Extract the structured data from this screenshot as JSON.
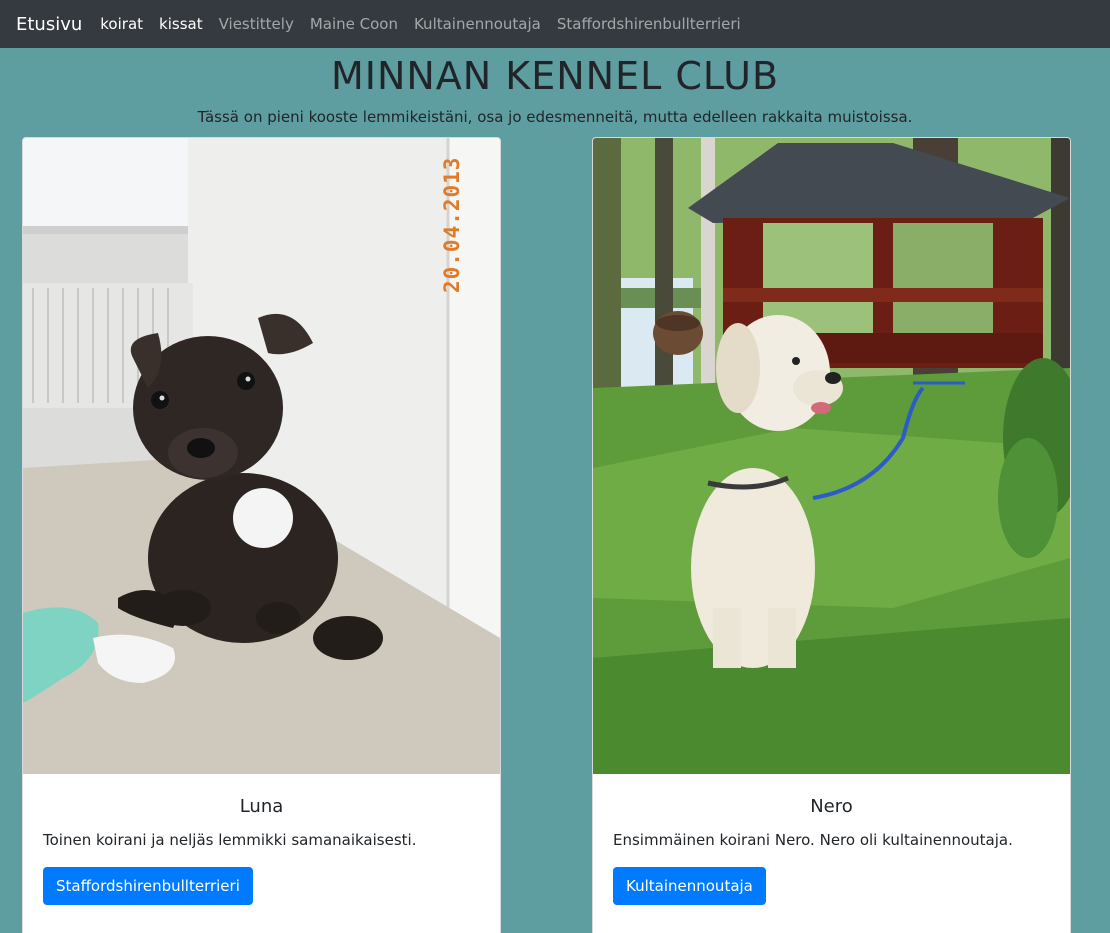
{
  "nav": {
    "brand": "Etusivu",
    "links": [
      {
        "label": "koirat",
        "active": true
      },
      {
        "label": "kissat",
        "active": true
      },
      {
        "label": "Viestittely",
        "active": false
      },
      {
        "label": "Maine Coon",
        "active": false
      },
      {
        "label": "Kultainennoutaja",
        "active": false
      },
      {
        "label": "Staffordshirenbullterrieri",
        "active": false
      }
    ]
  },
  "hero": {
    "title": "MINNAN KENNEL CLUB",
    "subtitle": "Tässä on pieni kooste lemmikeistäni, osa jo edesmenneitä, mutta edelleen rakkaita muistoissa."
  },
  "cards": [
    {
      "name": "Luna",
      "text": "Toinen koirani ja neljäs lemmikki samanaikaisesti.",
      "button": "Staffordshirenbullterrieri",
      "photo_date": "20.04.2013"
    },
    {
      "name": "Nero",
      "text": "Ensimmäinen koirani Nero. Nero oli kultainennoutaja.",
      "button": "Kultainennoutaja"
    }
  ],
  "colors": {
    "navbar": "#343a40",
    "background": "#5f9ea0",
    "button": "#007bff"
  }
}
